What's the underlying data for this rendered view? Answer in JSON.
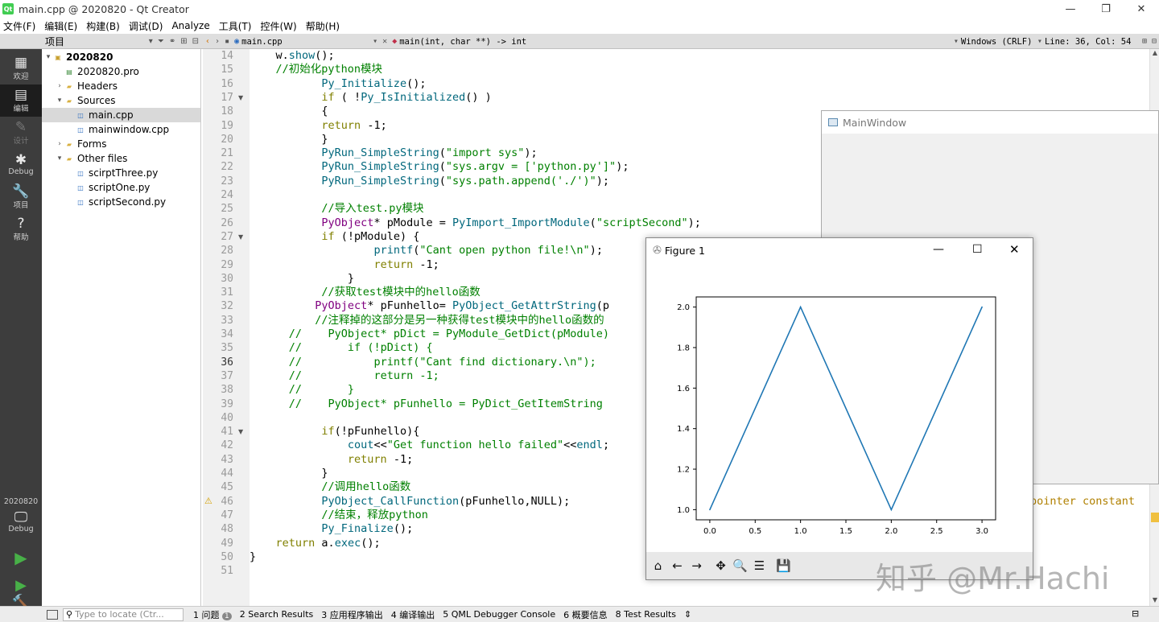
{
  "window": {
    "title": "main.cpp @ 2020820 - Qt Creator",
    "icon": "Qt"
  },
  "menubar": [
    "文件(F)",
    "编辑(E)",
    "构建(B)",
    "调试(D)",
    "Analyze",
    "工具(T)",
    "控件(W)",
    "帮助(H)"
  ],
  "toolbar": {
    "project_label": "项目",
    "file_name": "main.cpp",
    "function": "main(int, char **) -> int",
    "line_ending": "Windows (CRLF)",
    "position": "Line: 36, Col: 54"
  },
  "modes": [
    {
      "label": "欢迎",
      "icon": "grid-icon"
    },
    {
      "label": "编辑",
      "icon": "edit-icon"
    },
    {
      "label": "设计",
      "icon": "design-icon"
    },
    {
      "label": "Debug",
      "icon": "bug-icon"
    },
    {
      "label": "项目",
      "icon": "wrench-icon"
    },
    {
      "label": "帮助",
      "icon": "help-icon"
    }
  ],
  "kit": {
    "name": "2020820",
    "config": "Debug"
  },
  "tree": [
    {
      "label": "2020820",
      "level": 0,
      "arrow": "▾",
      "icon": "project-icon",
      "bold": true
    },
    {
      "label": "2020820.pro",
      "level": 1,
      "arrow": "",
      "icon": "pro-file-icon"
    },
    {
      "label": "Headers",
      "level": 1,
      "arrow": "›",
      "icon": "folder-icon"
    },
    {
      "label": "Sources",
      "level": 1,
      "arrow": "▾",
      "icon": "folder-icon"
    },
    {
      "label": "main.cpp",
      "level": 2,
      "arrow": "",
      "icon": "cpp-file-icon",
      "selected": true
    },
    {
      "label": "mainwindow.cpp",
      "level": 2,
      "arrow": "",
      "icon": "cpp-file-icon"
    },
    {
      "label": "Forms",
      "level": 1,
      "arrow": "›",
      "icon": "folder-icon"
    },
    {
      "label": "Other files",
      "level": 1,
      "arrow": "▾",
      "icon": "folder-icon"
    },
    {
      "label": "scirptThree.py",
      "level": 2,
      "arrow": "",
      "icon": "py-file-icon"
    },
    {
      "label": "scriptOne.py",
      "level": 2,
      "arrow": "",
      "icon": "py-file-icon"
    },
    {
      "label": "scriptSecond.py",
      "level": 2,
      "arrow": "",
      "icon": "py-file-icon"
    }
  ],
  "current_line": 36,
  "code_lines": [
    {
      "n": 14,
      "t": "    w.show();"
    },
    {
      "n": 15,
      "t": "    //初始化python模块"
    },
    {
      "n": 16,
      "t": "           Py_Initialize();"
    },
    {
      "n": 17,
      "t": "           if ( !Py_IsInitialized() )",
      "fold": true
    },
    {
      "n": 18,
      "t": "           {"
    },
    {
      "n": 19,
      "t": "           return -1;"
    },
    {
      "n": 20,
      "t": "           }"
    },
    {
      "n": 21,
      "t": "           PyRun_SimpleString(\"import sys\");"
    },
    {
      "n": 22,
      "t": "           PyRun_SimpleString(\"sys.argv = ['python.py']\");"
    },
    {
      "n": 23,
      "t": "           PyRun_SimpleString(\"sys.path.append('./')\");"
    },
    {
      "n": 24,
      "t": ""
    },
    {
      "n": 25,
      "t": "           //导入test.py模块"
    },
    {
      "n": 26,
      "t": "           PyObject* pModule = PyImport_ImportModule(\"scriptSecond\");"
    },
    {
      "n": 27,
      "t": "           if (!pModule) {",
      "fold": true
    },
    {
      "n": 28,
      "t": "                   printf(\"Cant open python file!\\n\");"
    },
    {
      "n": 29,
      "t": "                   return -1;"
    },
    {
      "n": 30,
      "t": "               }"
    },
    {
      "n": 31,
      "t": "           //获取test模块中的hello函数"
    },
    {
      "n": 32,
      "t": "          PyObject* pFunhello= PyObject_GetAttrString(p"
    },
    {
      "n": 33,
      "t": "          //注释掉的这部分是另一种获得test模块中的hello函数的"
    },
    {
      "n": 34,
      "t": "      //    PyObject* pDict = PyModule_GetDict(pModule)"
    },
    {
      "n": 35,
      "t": "      //       if (!pDict) {"
    },
    {
      "n": 36,
      "t": "      //           printf(\"Cant find dictionary.\\n\");"
    },
    {
      "n": 37,
      "t": "      //           return -1;"
    },
    {
      "n": 38,
      "t": "      //       }"
    },
    {
      "n": 39,
      "t": "      //    PyObject* pFunhello = PyDict_GetItemString"
    },
    {
      "n": 40,
      "t": ""
    },
    {
      "n": 41,
      "t": "           if(!pFunhello){",
      "fold": true
    },
    {
      "n": 42,
      "t": "               cout<<\"Get function hello failed\"<<endl;"
    },
    {
      "n": 43,
      "t": "               return -1;"
    },
    {
      "n": 44,
      "t": "           }"
    },
    {
      "n": 45,
      "t": "           //调用hello函数"
    },
    {
      "n": 46,
      "t": "           PyObject_CallFunction(pFunhello,NULL);",
      "warn": true
    },
    {
      "n": 47,
      "t": "           //结束，释放python"
    },
    {
      "n": 48,
      "t": "           Py_Finalize();"
    },
    {
      "n": 49,
      "t": "    return a.exec();"
    },
    {
      "n": 50,
      "t": "}"
    },
    {
      "n": 51,
      "t": ""
    }
  ],
  "warning_tail": "pointer constant",
  "main_window": {
    "title": "MainWindow"
  },
  "figure": {
    "title": "Figure 1",
    "tools": [
      "home-icon",
      "back-icon",
      "forward-icon",
      "pan-icon",
      "zoom-icon",
      "configure-icon",
      "save-icon"
    ]
  },
  "chart_data": {
    "type": "line",
    "x": [
      0,
      1,
      2,
      3
    ],
    "series": [
      {
        "values": [
          1,
          2,
          1,
          2
        ],
        "color": "#1f77b4"
      }
    ],
    "xlim": [
      -0.15,
      3.15
    ],
    "ylim": [
      0.95,
      2.05
    ],
    "xticks": [
      "0.0",
      "0.5",
      "1.0",
      "1.5",
      "2.0",
      "2.5",
      "3.0"
    ],
    "yticks": [
      "1.0",
      "1.2",
      "1.4",
      "1.6",
      "1.8",
      "2.0"
    ],
    "grid": false
  },
  "status": {
    "locator_placeholder": "Type to locate (Ctr...",
    "panes": [
      "1 问题",
      "2 Search Results",
      "3 应用程序输出",
      "4 编译输出",
      "5 QML Debugger Console",
      "6 概要信息",
      "8 Test Results"
    ],
    "issue_count": "1"
  },
  "watermark": "知乎 @Mr.Hachi"
}
